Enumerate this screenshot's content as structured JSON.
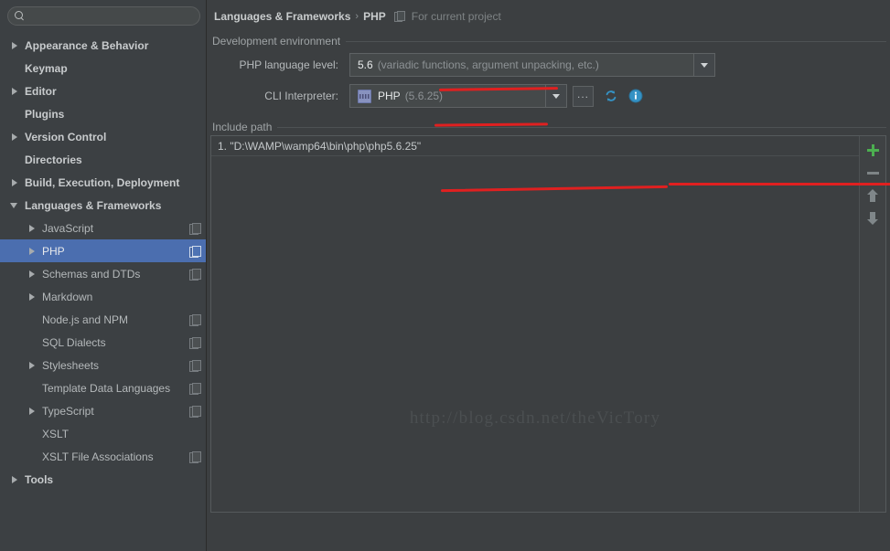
{
  "search": {
    "value": "",
    "placeholder": ""
  },
  "sidebar": {
    "items": [
      {
        "label": "Appearance & Behavior",
        "level": 0,
        "arrow": "right",
        "badge": false,
        "selected": false
      },
      {
        "label": "Keymap",
        "level": 0,
        "arrow": "none",
        "badge": false,
        "selected": false
      },
      {
        "label": "Editor",
        "level": 0,
        "arrow": "right",
        "badge": false,
        "selected": false
      },
      {
        "label": "Plugins",
        "level": 0,
        "arrow": "none",
        "badge": false,
        "selected": false
      },
      {
        "label": "Version Control",
        "level": 0,
        "arrow": "right",
        "badge": false,
        "selected": false
      },
      {
        "label": "Directories",
        "level": 0,
        "arrow": "none",
        "badge": false,
        "selected": false
      },
      {
        "label": "Build, Execution, Deployment",
        "level": 0,
        "arrow": "right",
        "badge": false,
        "selected": false
      },
      {
        "label": "Languages & Frameworks",
        "level": 0,
        "arrow": "down",
        "badge": false,
        "selected": false
      },
      {
        "label": "JavaScript",
        "level": 1,
        "arrow": "right",
        "badge": true,
        "selected": false
      },
      {
        "label": "PHP",
        "level": 1,
        "arrow": "right",
        "badge": true,
        "selected": true
      },
      {
        "label": "Schemas and DTDs",
        "level": 1,
        "arrow": "right",
        "badge": true,
        "selected": false
      },
      {
        "label": "Markdown",
        "level": 1,
        "arrow": "right",
        "badge": false,
        "selected": false
      },
      {
        "label": "Node.js and NPM",
        "level": 1,
        "arrow": "none",
        "badge": true,
        "selected": false
      },
      {
        "label": "SQL Dialects",
        "level": 1,
        "arrow": "none",
        "badge": true,
        "selected": false
      },
      {
        "label": "Stylesheets",
        "level": 1,
        "arrow": "right",
        "badge": true,
        "selected": false
      },
      {
        "label": "Template Data Languages",
        "level": 1,
        "arrow": "none",
        "badge": true,
        "selected": false
      },
      {
        "label": "TypeScript",
        "level": 1,
        "arrow": "right",
        "badge": true,
        "selected": false
      },
      {
        "label": "XSLT",
        "level": 1,
        "arrow": "none",
        "badge": false,
        "selected": false
      },
      {
        "label": "XSLT File Associations",
        "level": 1,
        "arrow": "none",
        "badge": true,
        "selected": false
      },
      {
        "label": "Tools",
        "level": 0,
        "arrow": "right",
        "badge": false,
        "selected": false
      }
    ]
  },
  "breadcrumb": {
    "root": "Languages & Frameworks",
    "separator": "›",
    "leaf": "PHP",
    "scope_note": "For current project"
  },
  "dev_env": {
    "group_title": "Development environment",
    "language_level": {
      "label": "PHP language level:",
      "value": "5.6",
      "value_note": "(variadic functions, argument unpacking, etc.)"
    },
    "cli_interpreter": {
      "label": "CLI Interpreter:",
      "value": "PHP",
      "value_note": "(5.6.25)",
      "browse_label": "...",
      "refresh_icon": "refresh-icon",
      "info_icon": "info-icon"
    }
  },
  "include_path": {
    "group_title": "Include path",
    "entries": [
      "1. \"D:\\WAMP\\wamp64\\bin\\php\\php5.6.25\""
    ],
    "toolbar": {
      "add": "+",
      "remove": "−",
      "move_up": "move-up",
      "move_down": "move-down"
    }
  },
  "watermark": {
    "text": "http://blog.csdn.net/theVicTory"
  },
  "colors": {
    "panel_bg": "#3c3f41",
    "sidebar_bg": "#3c4043",
    "selection": "#4b6eaf",
    "field_bg": "#45494a",
    "add_green": "#4caf50",
    "annotation_red": "#e02020",
    "php_violet": "#8892bf",
    "info_blue": "#3592c4"
  }
}
